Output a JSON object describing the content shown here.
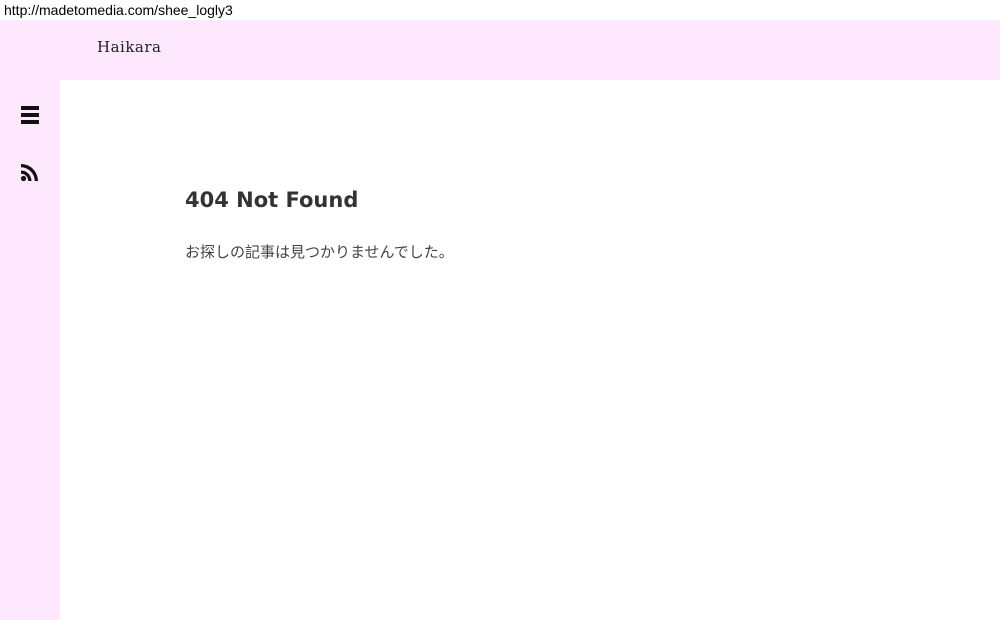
{
  "browser": {
    "url": "http://madetomedia.com/shee_logly3"
  },
  "header": {
    "site_title": "Haikara"
  },
  "sidebar": {
    "icons": [
      "menu-icon",
      "rss-icon"
    ]
  },
  "main": {
    "title": "404 Not Found",
    "message": "お探しの記事は見つかりませんでした。"
  },
  "colors": {
    "header_bg": "#fde8fd",
    "sidebar_bg": "#fde8fd",
    "content_bg": "#ffffff",
    "text": "#333333"
  }
}
